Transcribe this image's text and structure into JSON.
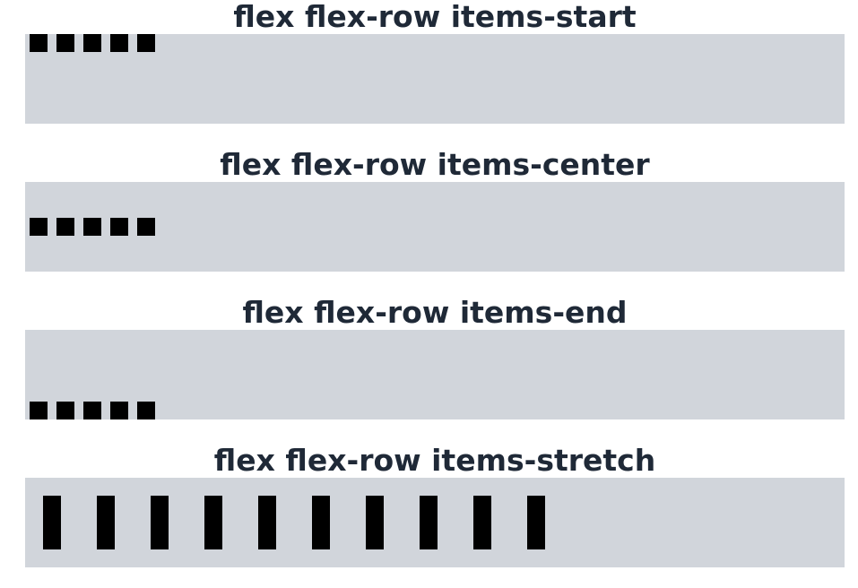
{
  "sections": [
    {
      "title": "flex flex-row items-start"
    },
    {
      "title": "flex flex-row items-center"
    },
    {
      "title": "flex flex-row items-end"
    },
    {
      "title": "flex flex-row items-stretch"
    }
  ],
  "square_count": 5,
  "bar_count": 10,
  "colors": {
    "box_background": "#d1d5db",
    "item": "#000000",
    "title": "#1f2937"
  }
}
